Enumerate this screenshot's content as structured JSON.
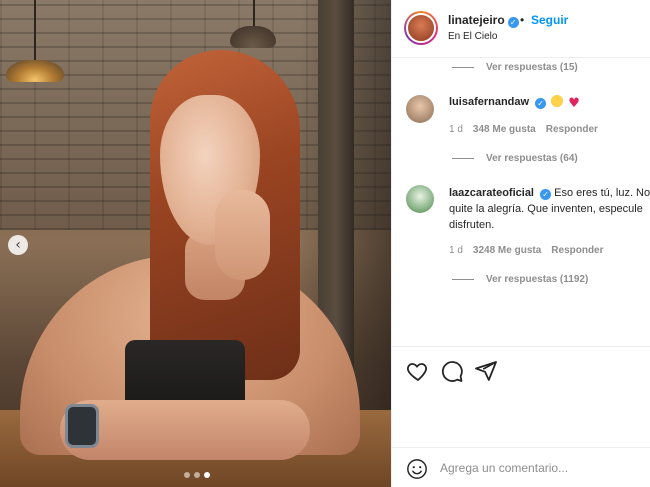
{
  "post": {
    "username": "linatejeiro",
    "follow_label": "Seguir",
    "separator": "•",
    "location": "En El Cielo",
    "verified_glyph": "✓"
  },
  "media": {
    "carousel_prev_glyph": "‹",
    "carousel_dots": 3,
    "carousel_active_index": 2
  },
  "comments": [
    {
      "replies_label": "Ver respuestas (15)"
    },
    {
      "username": "luisafernandaw",
      "text": "",
      "emojis": [
        "star-struck-emoji",
        "red-heart-emoji"
      ],
      "time": "1 d",
      "likes": "348 Me gusta",
      "reply_label": "Responder",
      "replies_label": "Ver respuestas (64)"
    },
    {
      "username": "laazcarateoficial",
      "text_line1": "Eso eres tú, luz. No",
      "text_line2": "quite la alegría. Que inventen, especule",
      "text_line3": "disfruten.",
      "time": "1 d",
      "likes": "3248 Me gusta",
      "reply_label": "Responder",
      "replies_label": "Ver respuestas (1192)"
    }
  ],
  "actions": {
    "icons": [
      "heart-icon",
      "comment-icon",
      "share-icon"
    ]
  },
  "add_comment": {
    "placeholder": "Agrega un comentario..."
  },
  "colors": {
    "link_blue": "#0095f6",
    "verified_blue": "#3897f0",
    "muted_text": "#8e8e8e",
    "heart_red": "#e0245e"
  }
}
